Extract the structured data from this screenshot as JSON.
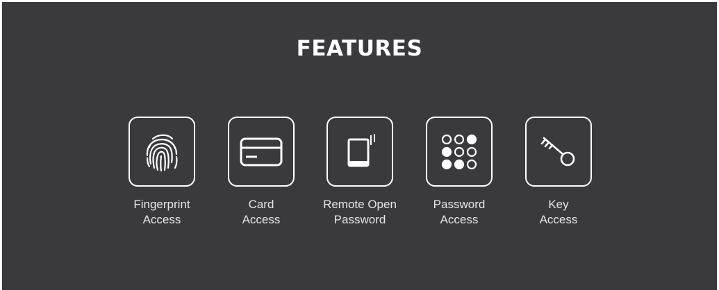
{
  "title": "FEATURES",
  "colors": {
    "background": "#3a3a3c",
    "foreground": "#ffffff"
  },
  "features": [
    {
      "icon": "fingerprint-icon",
      "label_line1": "Fingerprint",
      "label_line2": "Access"
    },
    {
      "icon": "card-icon",
      "label_line1": "Card",
      "label_line2": "Access"
    },
    {
      "icon": "phone-remote-icon",
      "label_line1": "Remote Open",
      "label_line2": "Password"
    },
    {
      "icon": "keypad-icon",
      "label_line1": "Password",
      "label_line2": "Access"
    },
    {
      "icon": "key-icon",
      "label_line1": "Key",
      "label_line2": "Access"
    }
  ]
}
